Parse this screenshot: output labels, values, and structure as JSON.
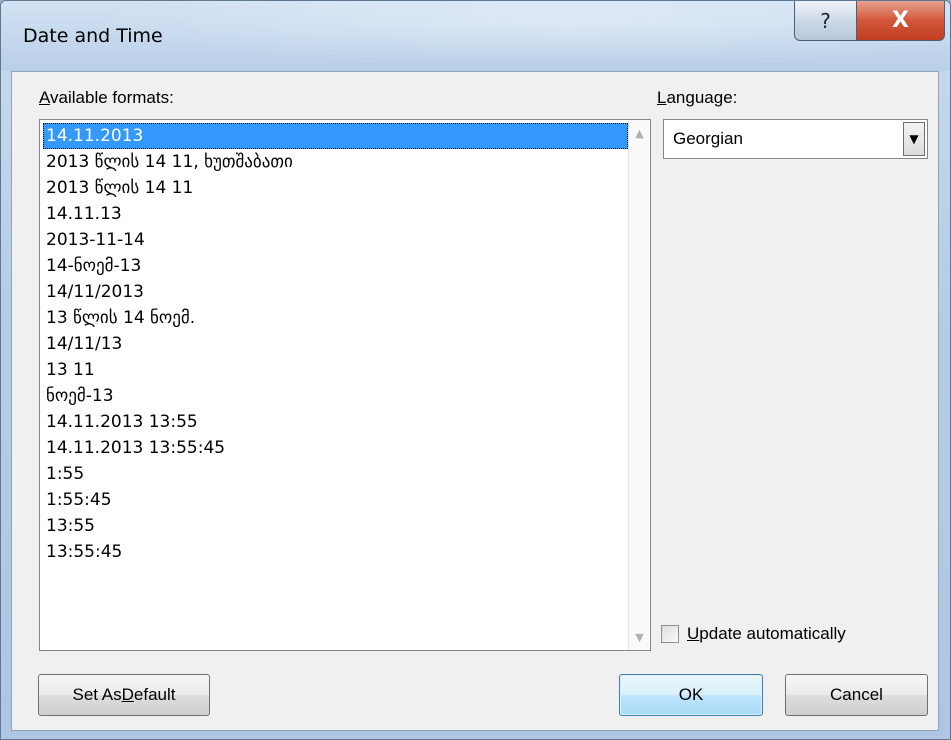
{
  "window": {
    "title": "Date and Time",
    "help_glyph": "?",
    "close_glyph": "X"
  },
  "formats": {
    "label_prefix": "",
    "label_accel": "A",
    "label_rest": "vailable formats:",
    "items": [
      "14.11.2013",
      "2013 წლის 14 11, ხუთშაბათი",
      "2013 წლის 14 11",
      "14.11.13",
      "2013-11-14",
      "14-ნოემ-13",
      "14/11/2013",
      "13 წლის 14 ნოემ.",
      "14/11/13",
      "13 11",
      "ნოემ-13",
      "14.11.2013 13:55",
      "14.11.2013 13:55:45",
      "1:55",
      "1:55:45",
      "13:55",
      "13:55:45"
    ],
    "selected_index": 0
  },
  "language": {
    "label_accel": "L",
    "label_rest": "anguage:",
    "selected": "Georgian"
  },
  "update_automatically": {
    "label_accel": "U",
    "label_rest": "pdate automatically",
    "checked": false
  },
  "buttons": {
    "set_default_pre": "Set As ",
    "set_default_accel": "D",
    "set_default_post": "efault",
    "ok": "OK",
    "cancel": "Cancel"
  },
  "colors": {
    "selection": "#3399ff",
    "close_button": "#c13d20"
  }
}
